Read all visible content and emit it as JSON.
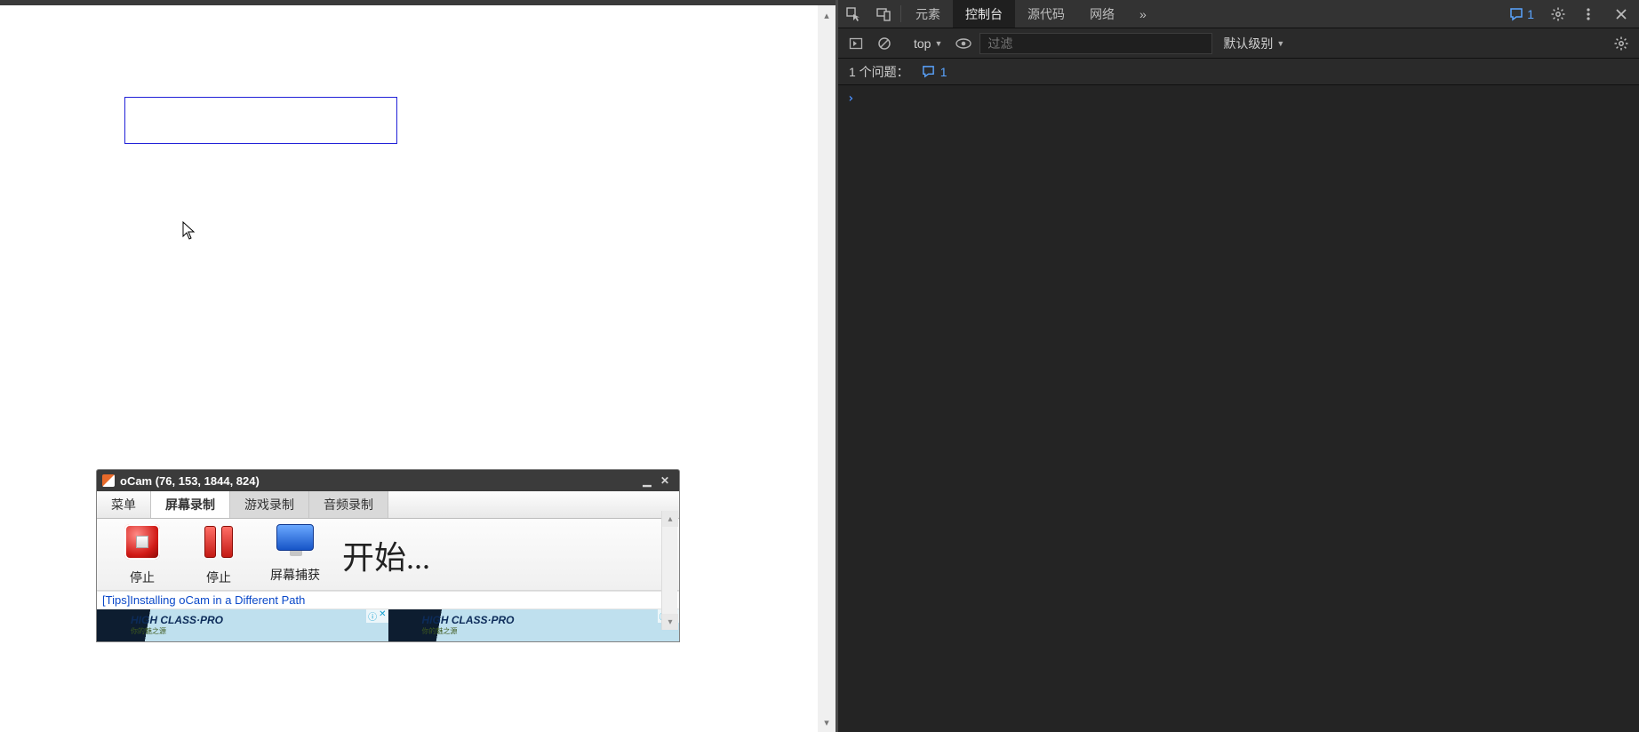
{
  "viewport": {
    "blue_box_text": ""
  },
  "ocam": {
    "title": "oCam (76, 153, 1844, 824)",
    "tabs": {
      "menu": "菜单",
      "screen": "屏幕录制",
      "game": "游戏录制",
      "audio": "音频录制"
    },
    "buttons": {
      "stop": "停止",
      "pause": "停止",
      "capture": "屏幕捕获"
    },
    "big_text": "开始...",
    "tips": "[Tips]Installing oCam in a Different Path",
    "ad": {
      "info_icon": "ⓘ",
      "close_icon": "✕",
      "brand": "HIGH CLASS·PRO",
      "brand_sub": "你的魅之源"
    }
  },
  "devtools": {
    "tabs": {
      "elements": "元素",
      "console": "控制台",
      "sources": "源代码",
      "network": "网络",
      "more": "»"
    },
    "badge_count": "1",
    "toolbar": {
      "context": "top",
      "filter_placeholder": "过滤",
      "level": "默认级别"
    },
    "issues": {
      "label": "1 个问题：",
      "count": "1"
    },
    "prompt": "›"
  }
}
